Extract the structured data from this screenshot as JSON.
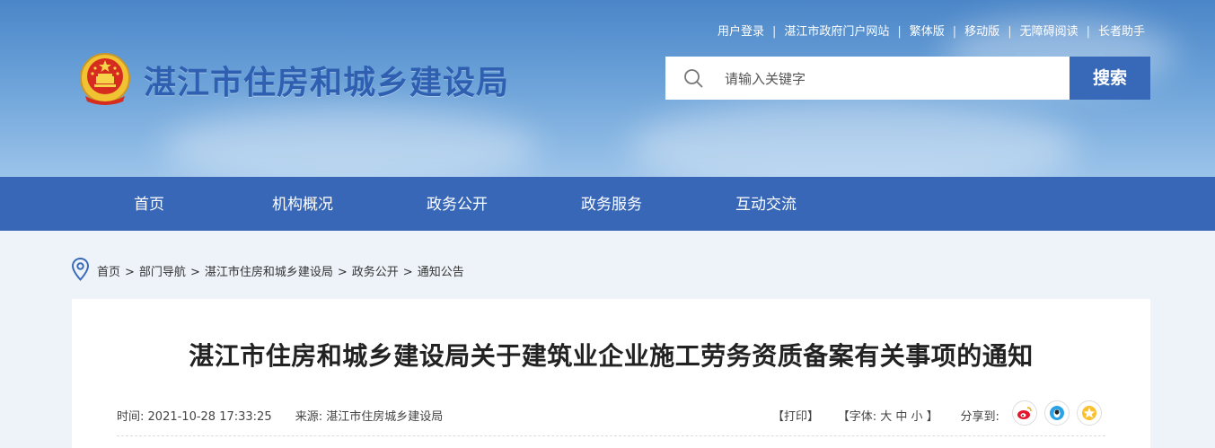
{
  "header": {
    "site_title": "湛江市住房和城乡建设局",
    "top_links": [
      "用户登录",
      "湛江市政府门户网站",
      "繁体版",
      "移动版",
      "无障碍阅读",
      "长者助手"
    ],
    "separator": "|",
    "search": {
      "placeholder": "请输入关键字",
      "button_label": "搜索"
    }
  },
  "nav": {
    "items": [
      "首页",
      "机构概况",
      "政务公开",
      "政务服务",
      "互动交流"
    ]
  },
  "breadcrumb": {
    "items": [
      "首页",
      "部门导航",
      "湛江市住房和城乡建设局",
      "政务公开",
      "通知公告"
    ],
    "separator": ">"
  },
  "article": {
    "title": "湛江市住房和城乡建设局关于建筑业企业施工劳务资质备案有关事项的通知",
    "time_label": "时间:",
    "time": "2021-10-28 17:33:25",
    "source_label": "来源:",
    "source": "湛江市住房城乡建设局",
    "print": "【打印】",
    "font_label": "【字体:",
    "font_large": "大",
    "font_medium": "中",
    "font_small": "小",
    "font_close": "】",
    "share_label": "分享到:"
  },
  "colors": {
    "nav_bg": "#3867b7",
    "title_blue": "#2f5fb0",
    "search_btn": "#3868b8"
  },
  "icons": [
    "national-emblem-icon",
    "search-icon",
    "location-pin-icon",
    "weibo-icon",
    "qq-icon",
    "qzone-icon"
  ]
}
